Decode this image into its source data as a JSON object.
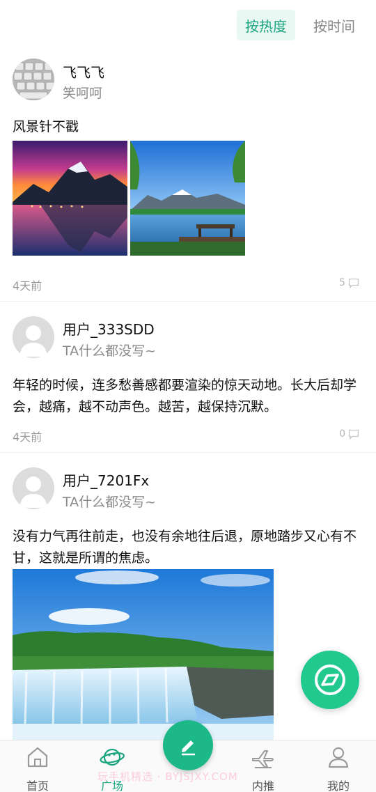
{
  "sort_tabs": {
    "hot": "按热度",
    "time": "按时间"
  },
  "posts": [
    {
      "username": "飞飞飞",
      "subtitle": "笑呵呵",
      "content": "风景针不戳",
      "time": "4天前",
      "comments": "5",
      "images": [
        "sunset-mountain-lake",
        "lake-bench-mountains"
      ]
    },
    {
      "username": "用户_333SDD",
      "subtitle": "TA什么都没写~",
      "content": "年轻的时候，连多愁善感都要渲染的惊天动地。长大后却学会，越痛，越不动声色。越苦，越保持沉默。",
      "time": "4天前",
      "comments": "0"
    },
    {
      "username": "用户_7201Fx",
      "subtitle": "TA什么都没写~",
      "content": "没有力气再往前走，也没有余地往后退，原地踏步又心有不甘，这就是所谓的焦虑。",
      "images": [
        "waterfall"
      ]
    }
  ],
  "nav": {
    "home": "首页",
    "square": "广场",
    "referral": "内推",
    "mine": "我的"
  },
  "watermark": "玩手机精选 · BYJSJXY.COM",
  "colors": {
    "accent": "#1aa57e",
    "fab": "#22c98f"
  },
  "icons": {
    "fab": "compass-icon",
    "compose": "pencil-icon",
    "home": "house-icon",
    "square": "planet-icon",
    "referral": "plane-icon",
    "mine": "person-icon"
  }
}
